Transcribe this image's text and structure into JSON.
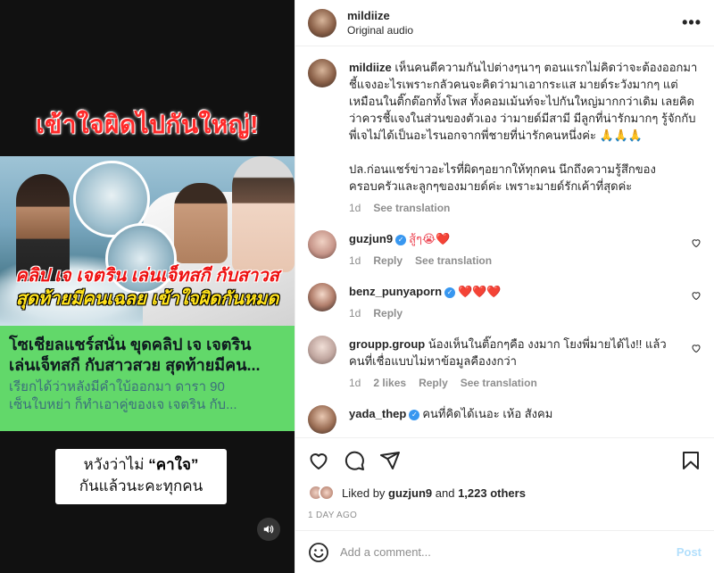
{
  "media": {
    "top_title": "เข้าใจผิดไปกันใหญ่!",
    "caption_red": "คลิป เจ เจตริน เล่นเจ็ทสกี กับสาวส",
    "caption_yellow": "สุดท้ายมีคนเฉลย เข้าใจผิดกันหมด",
    "headline_line1": "โซเชียลแชร์สนั่น ขุดคลิป เจ เจตริน",
    "headline_line2": "เล่นเจ็ทสกี กับสาวสวย สุดท้ายมีคน...",
    "sub_line1": "เรียกได้ว่าหลังมีคำใบ้ออกมา ดารา 90",
    "sub_line2": "เซ็นใบหย่า ก็ทำเอาคู่ของเจ เจตริน กับ...",
    "bottom_line1_a": "หวังว่าไม่ ",
    "bottom_line1_quote": "“คาใจ”",
    "bottom_line2": "กันแล้วนะคะทุกคน"
  },
  "header": {
    "username": "mildiize",
    "subtitle": "Original audio",
    "more_label": "•••"
  },
  "comments": [
    {
      "username": "mildiize",
      "verified": false,
      "paragraph1": "เห็นคนตีความกันไปต่างๆนาๆ ตอนแรกไม่คิดว่าจะต้องออกมาชี้แจงอะไรเพราะกลัวคนจะคิดว่ามาเอากระแส มายด์ระวังมากๆ แต่เหมือนในติ๊กต๊อกทั้งโพส ทั้งคอมเม้นท์จะไปกันใหญ่มากกว่าเดิม เลยคิดว่าควรชี้แจงในส่วนของตัวเอง ว่ามายด์มีสามี มีลูกที่น่ารักมากๆ รู้จักกับพี่เจไม่ได้เป็นอะไรนอกจากพี่ชายที่น่ารักคนหนึ่งค่ะ 🙏🙏🙏",
      "paragraph2": "ปล.ก่อนแชร์ข่าวอะไรที่ผิดๆอยากให้ทุกคน นึกถึงความรู้สึกของครอบครัวและลูกๆของมายด์ค่ะ เพราะมายด์รักเค้าที่สุดค่ะ",
      "time": "1d",
      "action": "See translation"
    },
    {
      "username": "guzjun9",
      "verified": true,
      "text": "สู้ๆ😭❤️",
      "time": "1d",
      "reply": "Reply",
      "action": "See translation"
    },
    {
      "username": "benz_punyaporn",
      "verified": true,
      "text": "❤️❤️❤️",
      "time": "1d",
      "reply": "Reply"
    },
    {
      "username": "groupp.group",
      "verified": false,
      "text": "น้องเห็นในติ๊อกๆคือ งงมาก โยงพี่มายได้ไง!! แล้วคนที่เชื่อแบบไม่หาข้อมูลคืองงกว่า",
      "time": "1d",
      "likes": "2 likes",
      "reply": "Reply",
      "action": "See translation"
    },
    {
      "username": "yada_thep",
      "verified": true,
      "text": "คนที่คิดได้เนอะ เห้อ สังคม"
    }
  ],
  "likes": {
    "prefix": "Liked by ",
    "user": "guzjun9",
    "and": " and ",
    "others": "1,223 others"
  },
  "date": "1 DAY AGO",
  "add_comment": {
    "placeholder": "Add a comment...",
    "post_label": "Post"
  },
  "colors": {
    "accent_blue": "#3897f0",
    "post_disabled": "#b2dffc",
    "heart_red": "#ed4956",
    "news_green": "#62d86a"
  }
}
